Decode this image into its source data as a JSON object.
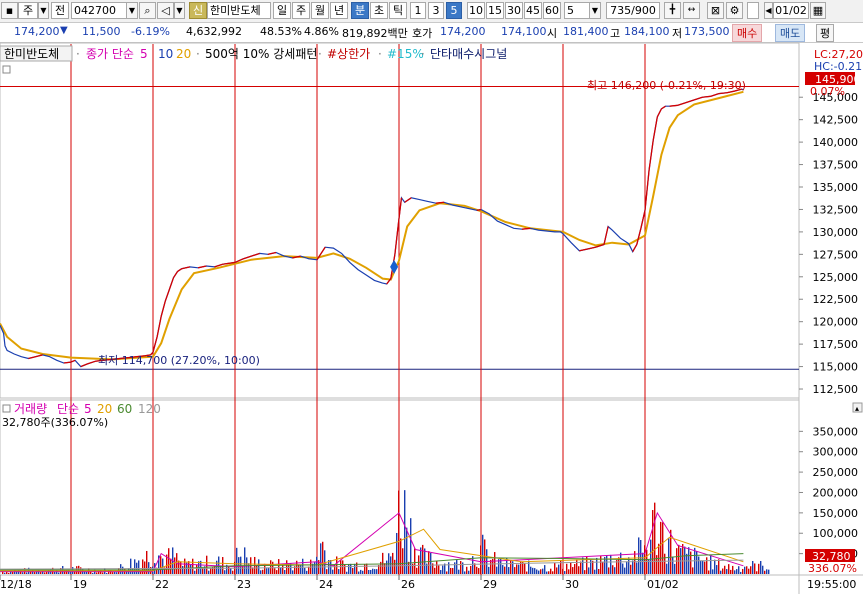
{
  "toolbar": {
    "market": "주",
    "period_mode": "전",
    "code": "042700",
    "shin": "신",
    "name": "한미반도체",
    "periods": [
      "일",
      "주",
      "월",
      "년",
      "분",
      "초",
      "틱"
    ],
    "active_period": "분",
    "intervals": [
      "1",
      "3",
      "5",
      "10",
      "15",
      "30",
      "45",
      "60"
    ],
    "active_interval": "5",
    "interval_value": "5",
    "page_count": "735/900",
    "date": "01/02",
    "icons": [
      "search-icon",
      "speaker-icon",
      "arrow-down-icon",
      "candle-toggle-icon",
      "crossbar-icon",
      "export-icon",
      "gear-icon",
      "checkbox",
      "calendar-icon"
    ]
  },
  "quote": {
    "price": "174,200",
    "change": "11,500",
    "rate": "-6.19%",
    "volume": "4,632,992",
    "volume_ratio": "48.53%",
    "turnover": "4.86%",
    "amount": "819,892백만",
    "bid_label": "호가",
    "bid": "174,200",
    "ask": "174,100",
    "open_label": "시",
    "open": "181,400",
    "high_label": "고",
    "high": "184,100",
    "low_label": "저",
    "low": "173,500",
    "buy": "매수",
    "sell": "매도",
    "eval": "평"
  },
  "legend": {
    "name": "한미반도체",
    "ma": "종가 단순",
    "ma_periods": [
      "5",
      "10",
      "20"
    ],
    "rank": "500억 10% 강세패턴",
    "limit_up": "#상한가",
    "pct15": "#15%",
    "signal": "단타매수시그널",
    "lc": "LC:27,20",
    "hc": "HC:-0.21"
  },
  "annotations": {
    "high": "최고 146,200 (-0.21%, 19:30)",
    "low": "최저 114,700 (27.20%, 10:00)",
    "last_price": "145,900",
    "last_pct": "0.07%",
    "last_volume": "32,780",
    "last_volume_pct": "336.07%"
  },
  "volume_legend": {
    "label": "거래량",
    "type": "단순",
    "periods": [
      "5",
      "20",
      "60",
      "120"
    ],
    "detail": "32,780주(336.07%)"
  },
  "colors": {
    "up": "#d40000",
    "down": "#1a3fb0",
    "ma5": "#d400b0",
    "ma20": "#e0a000",
    "ma60": "#4a8a30",
    "ma120": "#999999",
    "separator": "#d40000",
    "lowline": "#1a237e"
  },
  "chart_data": {
    "type": "candlestick",
    "x_labels": [
      "12/18",
      "19",
      "22",
      "23",
      "24",
      "26",
      "29",
      "30",
      "01/02"
    ],
    "time_label": "19:55:00",
    "price_ticks": [
      "145,000",
      "142,500",
      "140,000",
      "137,500",
      "135,000",
      "132,500",
      "130,000",
      "127,500",
      "125,000",
      "122,500",
      "120,000",
      "117,500",
      "115,000",
      "112,500"
    ],
    "ylim": [
      111500,
      148700
    ],
    "price_path": [
      [
        0,
        119600
      ],
      [
        0.05,
        118700
      ],
      [
        0.07,
        117300
      ],
      [
        0.1,
        116800
      ],
      [
        0.2,
        116400
      ],
      [
        0.3,
        116100
      ],
      [
        0.4,
        115900
      ],
      [
        0.5,
        116100
      ],
      [
        0.6,
        116300
      ],
      [
        0.7,
        116100
      ],
      [
        0.8,
        115700
      ],
      [
        0.9,
        115400
      ],
      [
        1,
        115500
      ],
      [
        1.05,
        115700
      ],
      [
        1.12,
        115000
      ],
      [
        1.2,
        115300
      ],
      [
        1.3,
        115600
      ],
      [
        1.4,
        115700
      ],
      [
        1.5,
        115800
      ],
      [
        1.6,
        115900
      ],
      [
        1.7,
        116000
      ],
      [
        1.8,
        116100
      ],
      [
        1.9,
        116200
      ],
      [
        1.97,
        116300
      ],
      [
        2,
        116600
      ],
      [
        2.05,
        118300
      ],
      [
        2.1,
        120600
      ],
      [
        2.15,
        122300
      ],
      [
        2.2,
        123600
      ],
      [
        2.25,
        124900
      ],
      [
        2.3,
        125600
      ],
      [
        2.35,
        125900
      ],
      [
        2.45,
        126100
      ],
      [
        2.55,
        126000
      ],
      [
        2.65,
        126200
      ],
      [
        2.75,
        126100
      ],
      [
        2.85,
        126400
      ],
      [
        3,
        126600
      ],
      [
        3.1,
        127000
      ],
      [
        3.2,
        127300
      ],
      [
        3.3,
        127600
      ],
      [
        3.4,
        127500
      ],
      [
        3.5,
        127700
      ],
      [
        3.6,
        127300
      ],
      [
        3.7,
        127100
      ],
      [
        3.8,
        127300
      ],
      [
        3.9,
        127000
      ],
      [
        4,
        126900
      ],
      [
        4.1,
        128300
      ],
      [
        4.2,
        128200
      ],
      [
        4.3,
        127600
      ],
      [
        4.4,
        126600
      ],
      [
        4.5,
        125800
      ],
      [
        4.6,
        125200
      ],
      [
        4.7,
        124600
      ],
      [
        4.8,
        124300
      ],
      [
        4.85,
        124200
      ],
      [
        4.9,
        124800
      ],
      [
        4.95,
        127500
      ],
      [
        5,
        131500
      ],
      [
        5.03,
        133800
      ],
      [
        5.07,
        133300
      ],
      [
        5.15,
        133800
      ],
      [
        5.25,
        133600
      ],
      [
        5.35,
        133400
      ],
      [
        5.45,
        133200
      ],
      [
        5.55,
        133300
      ],
      [
        5.65,
        133000
      ],
      [
        5.75,
        132800
      ],
      [
        5.85,
        132600
      ],
      [
        5.95,
        132400
      ],
      [
        6,
        132500
      ],
      [
        6.1,
        132000
      ],
      [
        6.2,
        131200
      ],
      [
        6.3,
        130800
      ],
      [
        6.4,
        130400
      ],
      [
        6.5,
        130300
      ],
      [
        6.6,
        130400
      ],
      [
        6.7,
        130200
      ],
      [
        6.8,
        130100
      ],
      [
        6.9,
        130000
      ],
      [
        6.97,
        130000
      ],
      [
        7,
        129800
      ],
      [
        7.1,
        128800
      ],
      [
        7.2,
        127900
      ],
      [
        7.3,
        128100
      ],
      [
        7.4,
        128300
      ],
      [
        7.5,
        128600
      ],
      [
        7.55,
        130600
      ],
      [
        7.6,
        130200
      ],
      [
        7.7,
        129300
      ],
      [
        7.8,
        128700
      ],
      [
        7.85,
        127800
      ],
      [
        7.9,
        128600
      ],
      [
        7.95,
        130400
      ],
      [
        8,
        132400
      ],
      [
        8.05,
        136900
      ],
      [
        8.1,
        140200
      ],
      [
        8.15,
        142800
      ],
      [
        8.2,
        143700
      ],
      [
        8.25,
        144000
      ],
      [
        8.3,
        144000
      ],
      [
        8.4,
        144100
      ],
      [
        8.5,
        144400
      ],
      [
        8.6,
        144700
      ],
      [
        8.7,
        145000
      ],
      [
        8.8,
        145100
      ],
      [
        8.9,
        145400
      ],
      [
        9,
        145500
      ],
      [
        9.1,
        145700
      ],
      [
        9.18,
        145900
      ],
      [
        9.2,
        145800
      ]
    ],
    "ma20_path": [
      [
        0,
        119800
      ],
      [
        0.1,
        118300
      ],
      [
        0.3,
        117000
      ],
      [
        0.6,
        116400
      ],
      [
        1,
        116000
      ],
      [
        1.5,
        115800
      ],
      [
        2,
        116100
      ],
      [
        2.1,
        117600
      ],
      [
        2.2,
        120300
      ],
      [
        2.35,
        123600
      ],
      [
        2.5,
        125400
      ],
      [
        2.8,
        126000
      ],
      [
        3.2,
        126900
      ],
      [
        3.6,
        127300
      ],
      [
        4,
        127100
      ],
      [
        4.2,
        127600
      ],
      [
        4.4,
        127000
      ],
      [
        4.6,
        126000
      ],
      [
        4.8,
        124800
      ],
      [
        4.9,
        124700
      ],
      [
        5,
        126800
      ],
      [
        5.1,
        130600
      ],
      [
        5.25,
        132400
      ],
      [
        5.5,
        133200
      ],
      [
        5.8,
        132900
      ],
      [
        6,
        132300
      ],
      [
        6.3,
        131100
      ],
      [
        6.6,
        130400
      ],
      [
        7,
        130000
      ],
      [
        7.2,
        129100
      ],
      [
        7.4,
        128500
      ],
      [
        7.6,
        128800
      ],
      [
        7.8,
        128600
      ],
      [
        8,
        129600
      ],
      [
        8.1,
        134000
      ],
      [
        8.2,
        138600
      ],
      [
        8.3,
        141600
      ],
      [
        8.4,
        143000
      ],
      [
        8.6,
        144200
      ],
      [
        8.9,
        144900
      ],
      [
        9.2,
        145600
      ]
    ],
    "signal_marker": [
      4.94,
      126100
    ],
    "volume_ticks": [
      "350,000",
      "300,000",
      "250,000",
      "200,000",
      "150,000",
      "100,000",
      "50,000"
    ],
    "volume_ylim": [
      0,
      395000
    ],
    "volume_peaks": [
      [
        0.5,
        16000
      ],
      [
        1.05,
        21000
      ],
      [
        1.5,
        13000
      ],
      [
        2.05,
        90000
      ],
      [
        2.1,
        60000
      ],
      [
        2.25,
        70000
      ],
      [
        2.35,
        36000
      ],
      [
        2.55,
        42000
      ],
      [
        2.8,
        48000
      ],
      [
        2.95,
        32000
      ],
      [
        3.05,
        88000
      ],
      [
        3.2,
        46000
      ],
      [
        3.4,
        34000
      ],
      [
        3.7,
        39000
      ],
      [
        3.95,
        40000
      ],
      [
        4.05,
        125000
      ],
      [
        4.15,
        49000
      ],
      [
        4.35,
        33000
      ],
      [
        4.6,
        41000
      ],
      [
        4.9,
        62000
      ],
      [
        5,
        265000
      ],
      [
        5.05,
        258000
      ],
      [
        5.1,
        210000
      ],
      [
        5.2,
        95000
      ],
      [
        5.3,
        64000
      ],
      [
        5.5,
        42000
      ],
      [
        5.8,
        38000
      ],
      [
        6.02,
        98000
      ],
      [
        6.1,
        58000
      ],
      [
        6.3,
        40000
      ],
      [
        6.55,
        32000
      ],
      [
        6.8,
        28000
      ],
      [
        7,
        34000
      ],
      [
        7.2,
        38000
      ],
      [
        7.4,
        45000
      ],
      [
        7.6,
        65000
      ],
      [
        7.8,
        60000
      ],
      [
        8.05,
        120000
      ],
      [
        8.1,
        205000
      ],
      [
        8.15,
        190000
      ],
      [
        8.2,
        170000
      ],
      [
        8.25,
        150000
      ],
      [
        8.35,
        90000
      ],
      [
        8.5,
        75000
      ],
      [
        8.7,
        55000
      ],
      [
        8.9,
        35000
      ],
      [
        9.1,
        24000
      ],
      [
        9.2,
        32780
      ]
    ],
    "volume_ma_levels": {
      "ma5": [
        [
          0,
          6000
        ],
        [
          2,
          6000
        ],
        [
          2.1,
          50000
        ],
        [
          2.3,
          25000
        ],
        [
          3,
          18000
        ],
        [
          4,
          30000
        ],
        [
          4.2,
          20000
        ],
        [
          5,
          150000
        ],
        [
          5.2,
          60000
        ],
        [
          6,
          30000
        ],
        [
          8,
          50000
        ],
        [
          8.15,
          150000
        ],
        [
          8.4,
          70000
        ],
        [
          9.2,
          20000
        ]
      ],
      "ma20": [
        [
          0,
          8000
        ],
        [
          2,
          8000
        ],
        [
          2.3,
          30000
        ],
        [
          3,
          25000
        ],
        [
          4,
          22000
        ],
        [
          5,
          80000
        ],
        [
          5.3,
          110000
        ],
        [
          5.5,
          60000
        ],
        [
          6.5,
          30000
        ],
        [
          8,
          40000
        ],
        [
          8.3,
          90000
        ],
        [
          8.6,
          70000
        ],
        [
          9.2,
          30000
        ]
      ],
      "ma60": [
        [
          0,
          10000
        ],
        [
          2,
          10000
        ],
        [
          3,
          20000
        ],
        [
          5,
          25000
        ],
        [
          6,
          40000
        ],
        [
          7,
          38000
        ],
        [
          8,
          35000
        ],
        [
          8.5,
          45000
        ],
        [
          9.2,
          50000
        ]
      ],
      "ma120": [
        [
          0,
          12000
        ],
        [
          3,
          14000
        ],
        [
          5,
          20000
        ],
        [
          7,
          28000
        ],
        [
          9.2,
          34000
        ]
      ]
    }
  }
}
